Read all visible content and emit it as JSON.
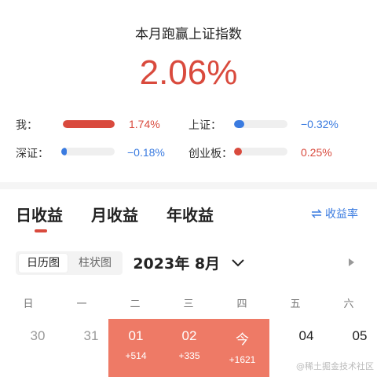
{
  "header": {
    "title": "本月跑赢上证指数",
    "value": "2.06%"
  },
  "comparisons": [
    {
      "label": "我：",
      "value": "1.74%",
      "level": 1.74,
      "color": "#d94a3d"
    },
    {
      "label": "上证：",
      "value": "−0.32%",
      "level": 0.32,
      "color": "#3a7be0"
    },
    {
      "label": "深证：",
      "value": "−0.18%",
      "level": 0.18,
      "color": "#3a7be0"
    },
    {
      "label": "创业板：",
      "value": "0.25%",
      "level": 0.25,
      "color": "#d94a3d"
    }
  ],
  "tabs": {
    "items": [
      "日收益",
      "月收益",
      "年收益"
    ],
    "active": 0,
    "rate_link": "收益率",
    "rate_icon": "swap-icon"
  },
  "calendar": {
    "view_toggle": [
      "日历图",
      "柱状图"
    ],
    "month_label": "2023年 8月",
    "weekdays": [
      "日",
      "一",
      "二",
      "三",
      "四",
      "五",
      "六"
    ],
    "days": [
      {
        "date": "30",
        "gain": ""
      },
      {
        "date": "31",
        "gain": ""
      },
      {
        "date": "01",
        "gain": "+514"
      },
      {
        "date": "02",
        "gain": "+335"
      },
      {
        "date": "今",
        "gain": "+1621"
      },
      {
        "date": "04",
        "gain": ""
      },
      {
        "date": "05",
        "gain": ""
      }
    ],
    "highlight_color": "#ee7a66"
  },
  "watermark": "@稀土掘金技术社区"
}
